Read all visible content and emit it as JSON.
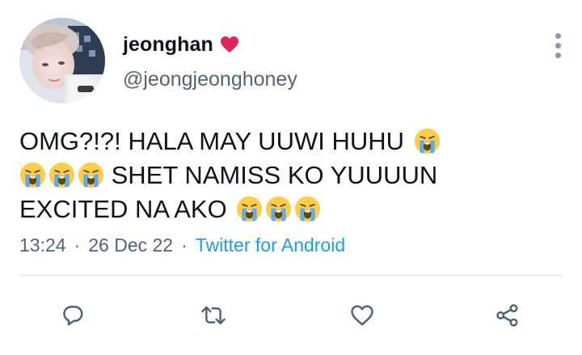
{
  "tweet": {
    "display_name": "jeonghan",
    "handle": "@jeongjeonghoney",
    "text_lines": [
      "OMG?!?! HALA MAY UUWI HUHU",
      "SHET NAMISS KO YUUUUN",
      "EXCITED NA AKO"
    ],
    "time": "13:24",
    "date": "26 Dec 22",
    "separator": "·",
    "source": "Twitter for Android"
  },
  "icons": {
    "name_badge": "red-heart-icon",
    "emoji": "loudly-crying-face-icon",
    "more": "more-vertical-icon",
    "reply": "reply-icon",
    "retweet": "retweet-icon",
    "like": "like-icon",
    "share": "share-icon"
  },
  "colors": {
    "text": "#0f1419",
    "secondary": "#536471",
    "link": "#1d9bf0",
    "heart": "#e0245e",
    "action_icon": "#536471"
  }
}
